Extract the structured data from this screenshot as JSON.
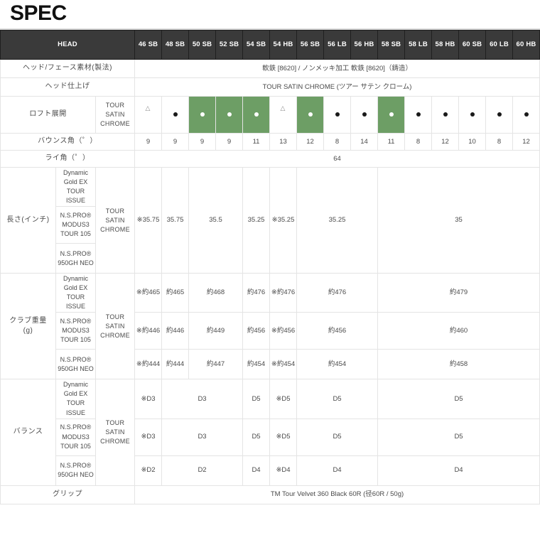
{
  "page": {
    "title": "SPEC"
  },
  "table": {
    "head_label": "HEAD",
    "columns": [
      "46 SB",
      "48 SB",
      "50 SB",
      "52 SB",
      "54 SB",
      "54 HB",
      "56 SB",
      "56 LB",
      "56 HB",
      "58 SB",
      "58 LB",
      "58 HB",
      "60 SB",
      "60 LB",
      "60 HB"
    ],
    "rows": {
      "material": {
        "label": "ヘッド/フェース素材(製法)",
        "value": "軟鉄 [8620] / ノンメッキ加工 軟鉄 [8620]（鋳造）"
      },
      "finish": {
        "label": "ヘッド仕上げ",
        "value": "TOUR SATIN CHROME (ツアー サテン クローム)"
      },
      "loft": {
        "label": "ロフト展開",
        "finish_label": "TOUR SATIN CHROME",
        "marks": [
          {
            "type": "triangle",
            "highlight": false
          },
          {
            "type": "dot",
            "highlight": false
          },
          {
            "type": "dot",
            "highlight": true
          },
          {
            "type": "dot",
            "highlight": true
          },
          {
            "type": "dot",
            "highlight": true
          },
          {
            "type": "triangle",
            "highlight": false
          },
          {
            "type": "dot",
            "highlight": true
          },
          {
            "type": "dot",
            "highlight": false
          },
          {
            "type": "dot",
            "highlight": false
          },
          {
            "type": "dot",
            "highlight": true
          },
          {
            "type": "dot",
            "highlight": false
          },
          {
            "type": "dot",
            "highlight": false
          },
          {
            "type": "dot",
            "highlight": false
          },
          {
            "type": "dot",
            "highlight": false
          },
          {
            "type": "dot",
            "highlight": false
          }
        ]
      },
      "bounce": {
        "label": "バウンス角（゜）",
        "values": [
          "9",
          "9",
          "9",
          "9",
          "11",
          "13",
          "12",
          "8",
          "14",
          "11",
          "8",
          "12",
          "10",
          "8",
          "12"
        ]
      },
      "lie": {
        "label": "ライ角（゜）",
        "value": "64"
      },
      "length": {
        "label": "長さ(インチ)",
        "finish_label": "TOUR SATIN CHROME",
        "shafts": [
          "Dynamic Gold EX TOUR ISSUE",
          "N.S.PRO® MODUS3 TOUR 105",
          "N.S.PRO® 950GH NEO"
        ],
        "shaft_lines": [
          [
            "Dynamic",
            "Gold EX",
            "TOUR",
            "ISSUE"
          ],
          [
            "N.S.PRO®",
            "MODUS3",
            "TOUR 105"
          ],
          [
            "N.S.PRO®",
            "950GH NEO"
          ]
        ],
        "cells": [
          {
            "text": "※35.75",
            "span": 1
          },
          {
            "text": "35.75",
            "span": 1
          },
          {
            "text": "35.5",
            "span": 2
          },
          {
            "text": "35.25",
            "span": 1
          },
          {
            "text": "※35.25",
            "span": 1
          },
          {
            "text": "35.25",
            "span": 3
          },
          {
            "text": "35",
            "span": 6
          }
        ]
      },
      "weight": {
        "label": "クラブ重量",
        "label_unit": "(g)",
        "finish_label": "TOUR SATIN CHROME",
        "shaft_lines": [
          [
            "Dynamic",
            "Gold EX",
            "TOUR",
            "ISSUE"
          ],
          [
            "N.S.PRO®",
            "MODUS3",
            "TOUR 105"
          ],
          [
            "N.S.PRO®",
            "950GH NEO"
          ]
        ],
        "series": [
          {
            "shaft": "Dynamic Gold EX TOUR ISSUE",
            "cells": [
              {
                "text": "※約465",
                "span": 1
              },
              {
                "text": "約465",
                "span": 1
              },
              {
                "text": "約468",
                "span": 2
              },
              {
                "text": "約476",
                "span": 1
              },
              {
                "text": "※約476",
                "span": 1
              },
              {
                "text": "約476",
                "span": 3
              },
              {
                "text": "約479",
                "span": 6
              }
            ]
          },
          {
            "shaft": "N.S.PRO® MODUS3 TOUR 105",
            "cells": [
              {
                "text": "※約446",
                "span": 1
              },
              {
                "text": "約446",
                "span": 1
              },
              {
                "text": "約449",
                "span": 2
              },
              {
                "text": "約456",
                "span": 1
              },
              {
                "text": "※約456",
                "span": 1
              },
              {
                "text": "約456",
                "span": 3
              },
              {
                "text": "約460",
                "span": 6
              }
            ]
          },
          {
            "shaft": "N.S.PRO® 950GH NEO",
            "cells": [
              {
                "text": "※約444",
                "span": 1
              },
              {
                "text": "約444",
                "span": 1
              },
              {
                "text": "約447",
                "span": 2
              },
              {
                "text": "約454",
                "span": 1
              },
              {
                "text": "※約454",
                "span": 1
              },
              {
                "text": "約454",
                "span": 3
              },
              {
                "text": "約458",
                "span": 6
              }
            ]
          }
        ]
      },
      "balance": {
        "label": "バランス",
        "finish_label": "TOUR SATIN CHROME",
        "shaft_lines": [
          [
            "Dynamic",
            "Gold EX",
            "TOUR",
            "ISSUE"
          ],
          [
            "N.S.PRO®",
            "MODUS3",
            "TOUR 105"
          ],
          [
            "N.S.PRO®",
            "950GH NEO"
          ]
        ],
        "series": [
          {
            "shaft": "Dynamic Gold EX TOUR ISSUE",
            "cells": [
              {
                "text": "※D3",
                "span": 1
              },
              {
                "text": "D3",
                "span": 3
              },
              {
                "text": "D5",
                "span": 1
              },
              {
                "text": "※D5",
                "span": 1
              },
              {
                "text": "D5",
                "span": 3
              },
              {
                "text": "D5",
                "span": 6
              }
            ]
          },
          {
            "shaft": "N.S.PRO® MODUS3 TOUR 105",
            "cells": [
              {
                "text": "※D3",
                "span": 1
              },
              {
                "text": "D3",
                "span": 3
              },
              {
                "text": "D5",
                "span": 1
              },
              {
                "text": "※D5",
                "span": 1
              },
              {
                "text": "D5",
                "span": 3
              },
              {
                "text": "D5",
                "span": 6
              }
            ]
          },
          {
            "shaft": "N.S.PRO® 950GH NEO",
            "cells": [
              {
                "text": "※D2",
                "span": 1
              },
              {
                "text": "D2",
                "span": 3
              },
              {
                "text": "D4",
                "span": 1
              },
              {
                "text": "※D4",
                "span": 1
              },
              {
                "text": "D4",
                "span": 3
              },
              {
                "text": "D4",
                "span": 6
              }
            ]
          }
        ]
      },
      "grip": {
        "label": "グリップ",
        "value": "TM Tour Velvet 360 Black 60R (径60R / 50g)"
      }
    }
  },
  "colors": {
    "highlight_green": "#6d9e65",
    "header_dark": "#3a3a3a",
    "border": "#e4e4e4"
  }
}
